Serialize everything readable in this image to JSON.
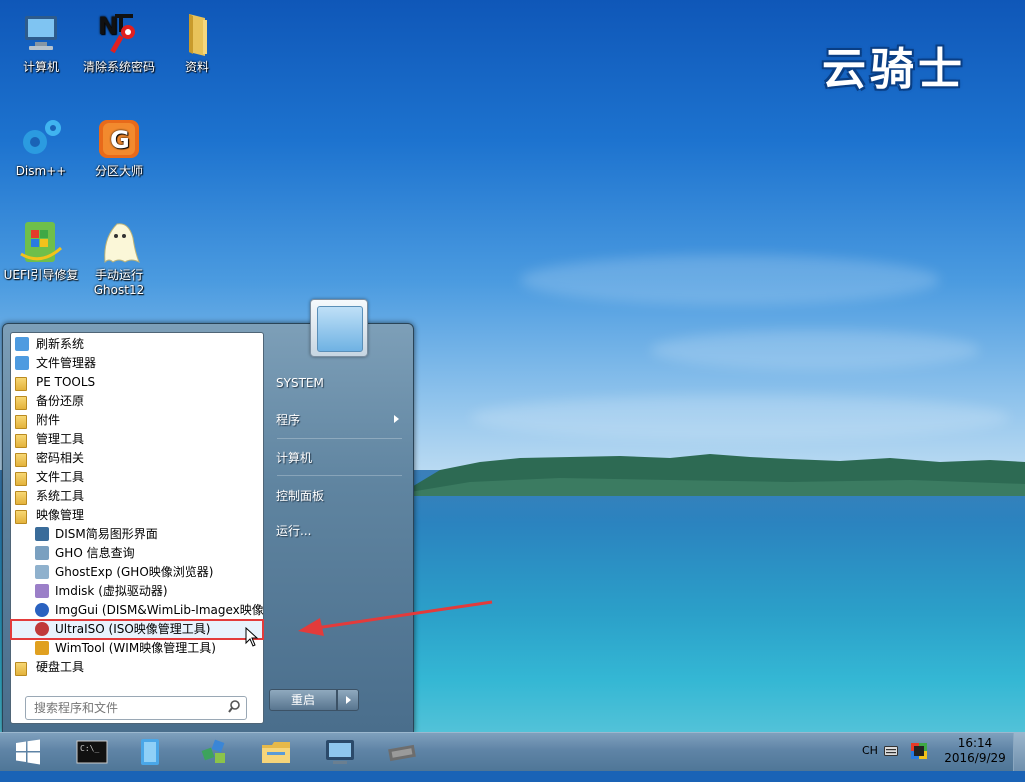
{
  "desktop": {
    "logo_text": "云骑士",
    "icons": [
      {
        "label": "计算机",
        "icon": "computer-icon"
      },
      {
        "label": "清除系统密码",
        "icon": "password-key-icon"
      },
      {
        "label": "资料",
        "icon": "folder-icon"
      },
      {
        "label": "Dism++",
        "icon": "gears-icon"
      },
      {
        "label": "分区大师",
        "icon": "partition-icon"
      },
      {
        "label": "UEFI引导修复",
        "icon": "uefi-repair-icon"
      },
      {
        "label": "手动运行",
        "label2": "Ghost12",
        "icon": "ghost-icon"
      }
    ]
  },
  "start_menu": {
    "programs": [
      {
        "label": "刷新系统",
        "icon": "refresh-folder-icon",
        "level": 0
      },
      {
        "label": "文件管理器",
        "icon": "file-manager-icon",
        "level": 0
      },
      {
        "label": "PE TOOLS",
        "icon": "folder-icon",
        "level": 0
      },
      {
        "label": "备份还原",
        "icon": "folder-icon",
        "level": 0
      },
      {
        "label": "附件",
        "icon": "folder-icon",
        "level": 0
      },
      {
        "label": "管理工具",
        "icon": "folder-icon",
        "level": 0
      },
      {
        "label": "密码相关",
        "icon": "folder-icon",
        "level": 0
      },
      {
        "label": "文件工具",
        "icon": "folder-icon",
        "level": 0
      },
      {
        "label": "系统工具",
        "icon": "folder-icon",
        "level": 0
      },
      {
        "label": "映像管理",
        "icon": "folder-icon",
        "level": 0
      },
      {
        "label": "DISM简易图形界面",
        "icon": "dism-icon",
        "level": 1
      },
      {
        "label": "GHO 信息查询",
        "icon": "gho-info-icon",
        "level": 1
      },
      {
        "label": "GhostExp (GHO映像浏览器)",
        "icon": "ghostexp-icon",
        "level": 1
      },
      {
        "label": "Imdisk (虚拟驱动器)",
        "icon": "imdisk-icon",
        "level": 1
      },
      {
        "label": "ImgGui (DISM&WimLib-Imagex映像",
        "icon": "imggui-icon",
        "level": 1
      },
      {
        "label": "UltraISO (ISO映像管理工具)",
        "icon": "ultraiso-icon",
        "level": 1,
        "highlighted": true
      },
      {
        "label": "WimTool (WIM映像管理工具)",
        "icon": "wimtool-icon",
        "level": 1
      },
      {
        "label": "硬盘工具",
        "icon": "folder-icon",
        "level": 0
      }
    ],
    "search_placeholder": "搜索程序和文件",
    "right_items": {
      "user": "SYSTEM",
      "programs": "程序",
      "computer": "计算机",
      "control_panel": "控制面板",
      "run": "运行..."
    },
    "restart_label": "重启"
  },
  "taskbar": {
    "buttons": [
      "start-windows-icon",
      "cmd-icon",
      "blue-app-icon",
      "network-cubes-icon",
      "explorer-folder-icon",
      "monitor-app-icon",
      "chip-drive-icon"
    ],
    "tray": {
      "ime": "CH"
    },
    "clock": {
      "time": "16:14",
      "date": "2016/9/29"
    }
  },
  "colors": {
    "highlight_border": "#e33b3b",
    "arrow": "#e33b3b"
  }
}
